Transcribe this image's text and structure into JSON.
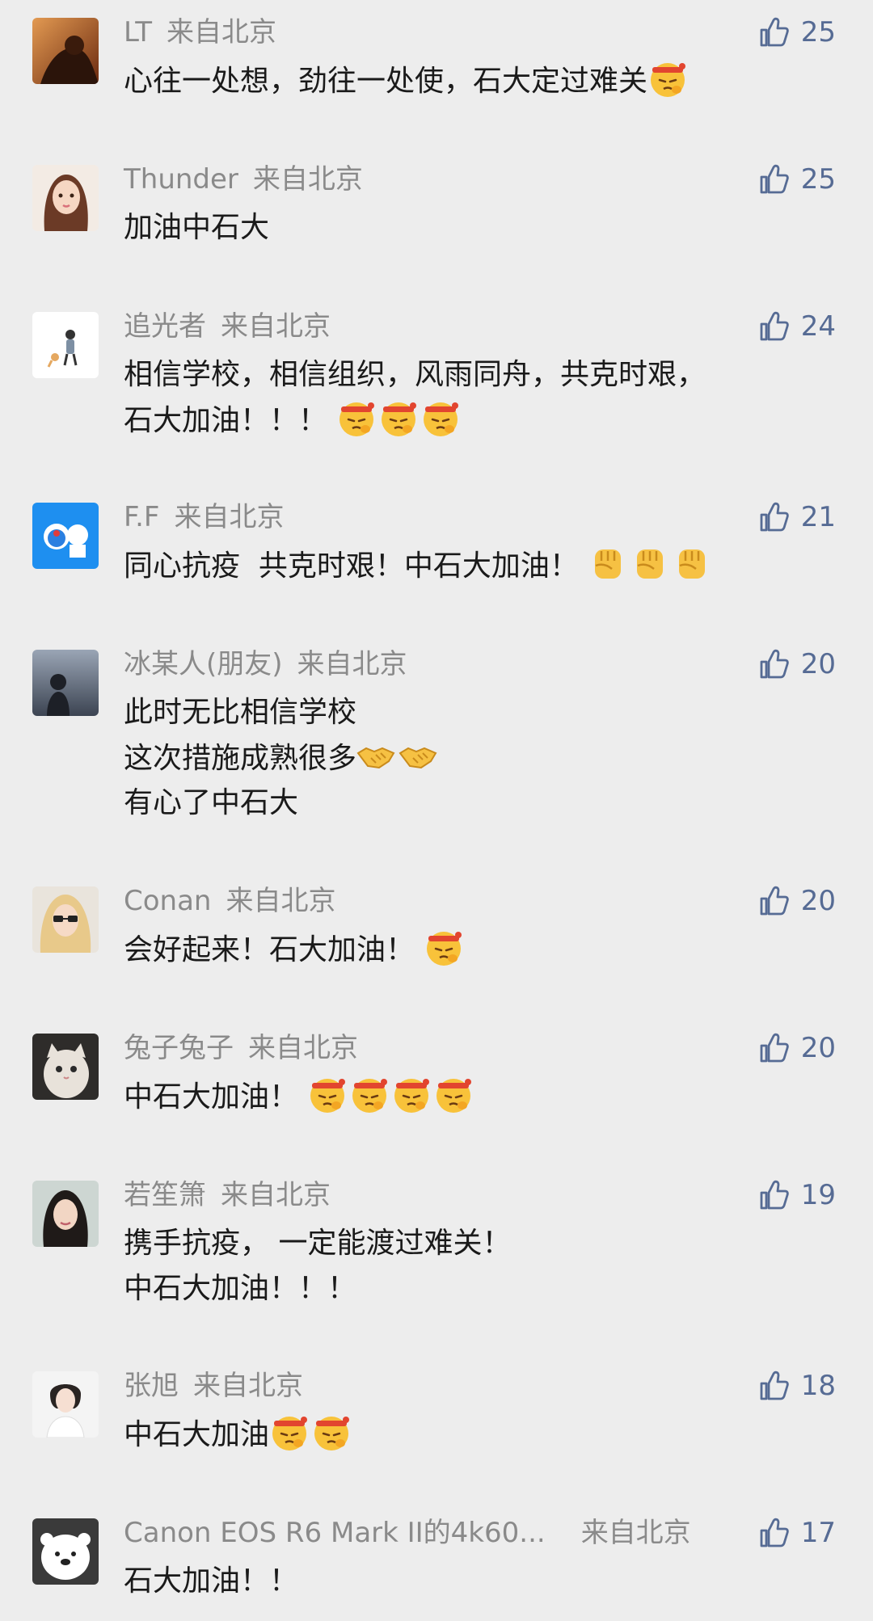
{
  "colors": {
    "background": "#ededed",
    "username": "#8a8a8a",
    "like": "#566b94",
    "text": "#1a1a1a"
  },
  "location_label": "来自北京",
  "comments": [
    {
      "user": "LT",
      "likes": "25",
      "lines": [
        "心往一处想，劲往一处使，石大定过难关"
      ],
      "emoji": [
        "headband-emoji"
      ]
    },
    {
      "user": "Thunder",
      "likes": "25",
      "lines": [
        "加油中石大"
      ]
    },
    {
      "user": "追光者",
      "likes": "24",
      "lines": [
        "相信学校，相信组织，风雨同舟，共克时艰，",
        "石大加油！！！"
      ],
      "emoji": [
        "headband-emoji",
        "headband-emoji",
        "headband-emoji"
      ]
    },
    {
      "user": "F.F",
      "likes": "21",
      "lines": [
        "同心抗疫  共克时艰！中石大加油！"
      ],
      "emoji": [
        "fist-emoji",
        "fist-emoji",
        "fist-emoji"
      ]
    },
    {
      "user": "冰某人(朋友)",
      "likes": "20",
      "lines": [
        "此时无比相信学校",
        "这次措施成熟很多",
        "有心了中石大"
      ],
      "emoji": [
        "handshake-emoji",
        "handshake-emoji"
      ]
    },
    {
      "user": "Conan",
      "likes": "20",
      "lines": [
        "会好起来！石大加油！"
      ],
      "emoji": [
        "headband-emoji"
      ]
    },
    {
      "user": "兔子兔子",
      "likes": "20",
      "lines": [
        "中石大加油！"
      ],
      "emoji": [
        "headband-emoji",
        "headband-emoji",
        "headband-emoji",
        "headband-emoji"
      ]
    },
    {
      "user": "若笙箫",
      "likes": "19",
      "lines": [
        "携手抗疫， 一定能渡过难关！",
        "中石大加油！！！"
      ]
    },
    {
      "user": "张旭",
      "likes": "18",
      "lines": [
        "中石大加油"
      ],
      "emoji": [
        "headband-emoji",
        "headband-emoji"
      ]
    },
    {
      "user": "Canon EOS R6 Mark II的4k60...",
      "likes": "17",
      "lines": [
        "石大加油！！"
      ]
    }
  ]
}
